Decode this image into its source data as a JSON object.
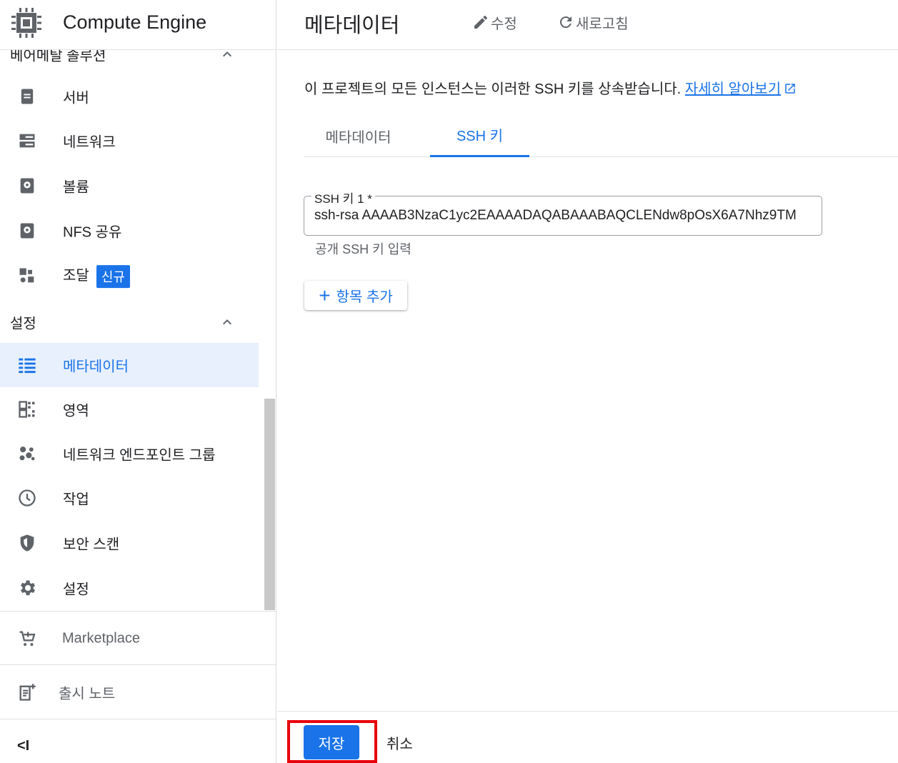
{
  "app": {
    "title": "Compute Engine"
  },
  "sidebar": {
    "sections": [
      {
        "label": "베어메탈 솔루션"
      },
      {
        "label": "설정"
      }
    ],
    "bare_metal_items": [
      {
        "label": "서버",
        "icon": "server-icon"
      },
      {
        "label": "네트워크",
        "icon": "network-icon"
      },
      {
        "label": "볼륨",
        "icon": "volume-icon"
      },
      {
        "label": "NFS 공유",
        "icon": "nfs-share-icon"
      },
      {
        "label": "조달",
        "icon": "procurement-icon",
        "badge": "신규"
      }
    ],
    "settings_items": [
      {
        "label": "메타데이터",
        "icon": "metadata-icon",
        "active": true
      },
      {
        "label": "영역",
        "icon": "zones-icon"
      },
      {
        "label": "네트워크 엔드포인트 그룹",
        "icon": "endpoint-group-icon"
      },
      {
        "label": "작업",
        "icon": "operations-icon"
      },
      {
        "label": "보안 스캔",
        "icon": "security-scan-icon"
      },
      {
        "label": "설정",
        "icon": "settings-gear-icon"
      }
    ],
    "footer": {
      "marketplace": "Marketplace",
      "release_notes": "출시 노트",
      "collapse": "<I"
    }
  },
  "header": {
    "title": "메타데이터",
    "edit_label": "수정",
    "refresh_label": "새로고침"
  },
  "main": {
    "description": "이 프로젝트의 모든 인스턴스는 이러한 SSH 키를 상속받습니다.",
    "learn_more": "자세히 알아보기",
    "tabs": [
      {
        "label": "메타데이터",
        "active": false
      },
      {
        "label": "SSH 키",
        "active": true
      }
    ],
    "ssh_field": {
      "label": "SSH 키 1 *",
      "value": "ssh-rsa AAAAB3NzaC1yc2EAAAADAQABAAABAQCLENdw8pOsX6A7Nhz9TM",
      "helper": "공개 SSH 키 입력"
    },
    "add_item_label": "항목 추가"
  },
  "footer_actions": {
    "save_label": "저장",
    "cancel_label": "취소"
  },
  "colors": {
    "accent": "#1a73e8",
    "active_bg": "#e8f0fe",
    "highlight": "#e8000b"
  }
}
